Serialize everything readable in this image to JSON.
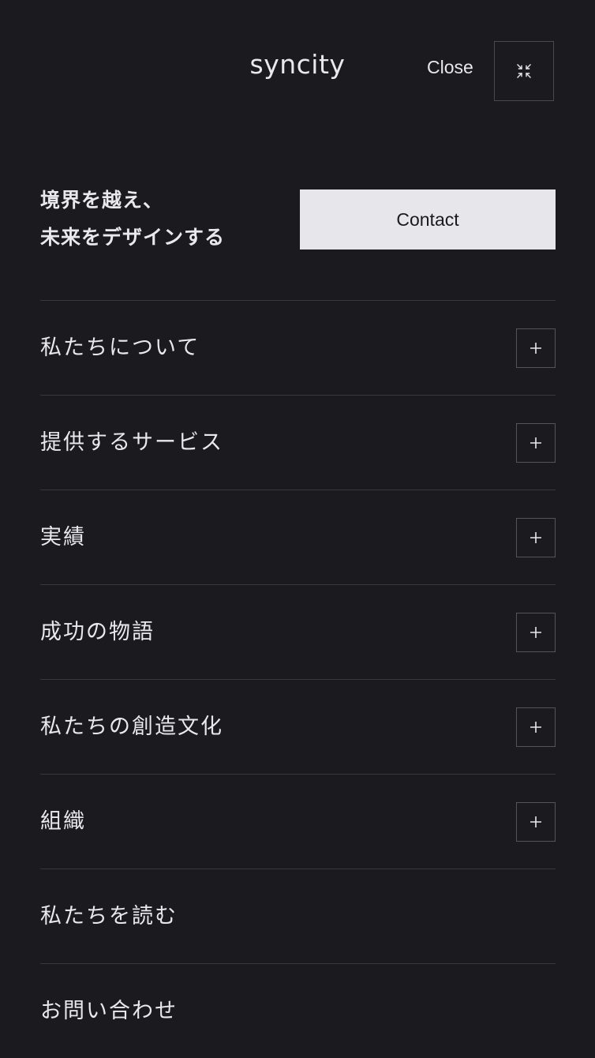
{
  "header": {
    "logo": "syncity",
    "close_label": "Close"
  },
  "hero": {
    "tagline_line1": "境界を越え、",
    "tagline_line2": "未来をデザインする",
    "contact_label": "Contact"
  },
  "menu": {
    "items": [
      {
        "label": "私たちについて",
        "expandable": true
      },
      {
        "label": "提供するサービス",
        "expandable": true
      },
      {
        "label": "実績",
        "expandable": true
      },
      {
        "label": "成功の物語",
        "expandable": true
      },
      {
        "label": "私たちの創造文化",
        "expandable": true
      },
      {
        "label": "組織",
        "expandable": true
      },
      {
        "label": "私たちを読む",
        "expandable": false
      },
      {
        "label": "お問い合わせ",
        "expandable": false
      }
    ]
  },
  "icons": {
    "close": "collapse-arrows-icon",
    "expand": "plus-icon"
  },
  "colors": {
    "background": "#1b1a1f",
    "text": "#e9e8ec",
    "button_bg": "#e7e6ea",
    "divider": "#38373d"
  }
}
